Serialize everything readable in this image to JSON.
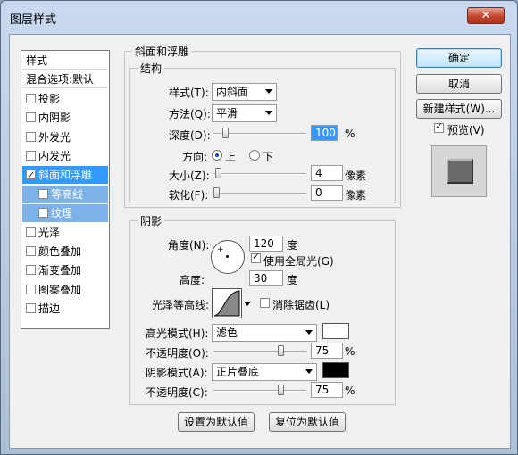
{
  "window": {
    "title": "图层样式",
    "close_glyph": "✕"
  },
  "left_list": [
    {
      "label": "样式",
      "checkbox": false,
      "state": "normal"
    },
    {
      "label": "混合选项:默认",
      "checkbox": false,
      "state": "normal"
    },
    {
      "label": "投影",
      "checkbox": true,
      "checked": false,
      "state": "normal"
    },
    {
      "label": "内阴影",
      "checkbox": true,
      "checked": false,
      "state": "normal"
    },
    {
      "label": "外发光",
      "checkbox": true,
      "checked": false,
      "state": "normal"
    },
    {
      "label": "内发光",
      "checkbox": true,
      "checked": false,
      "state": "normal"
    },
    {
      "label": "斜面和浮雕",
      "checkbox": true,
      "checked": true,
      "state": "selected"
    },
    {
      "label": "等高线",
      "checkbox": true,
      "checked": false,
      "state": "sub"
    },
    {
      "label": "纹理",
      "checkbox": true,
      "checked": false,
      "state": "sub"
    },
    {
      "label": "光泽",
      "checkbox": true,
      "checked": false,
      "state": "normal"
    },
    {
      "label": "颜色叠加",
      "checkbox": true,
      "checked": false,
      "state": "normal"
    },
    {
      "label": "渐变叠加",
      "checkbox": true,
      "checked": false,
      "state": "normal"
    },
    {
      "label": "图案叠加",
      "checkbox": true,
      "checked": false,
      "state": "normal"
    },
    {
      "label": "描边",
      "checkbox": true,
      "checked": false,
      "state": "normal"
    }
  ],
  "bevel": {
    "group_title": "斜面和浮雕",
    "structure_title": "结构",
    "style_label": "样式(T):",
    "style_value": "内斜面",
    "technique_label": "方法(Q):",
    "technique_value": "平滑",
    "depth_label": "深度(D):",
    "depth_value": "100",
    "depth_unit": "%",
    "depth_level": 0.1,
    "direction_label": "方向:",
    "dir_up": "上",
    "dir_down": "下",
    "size_label": "大小(Z):",
    "size_value": "4",
    "size_unit": "像素",
    "size_level": 0.02,
    "soften_label": "软化(F):",
    "soften_value": "0",
    "soften_unit": "像素",
    "soften_level": 0.0
  },
  "shading": {
    "title": "阴影",
    "angle_label": "角度(N):",
    "angle_value": "120",
    "angle_unit": "度",
    "global_light_label": "使用全局光(G)",
    "global_light_checked": true,
    "altitude_label": "高度:",
    "altitude_value": "30",
    "altitude_unit": "度",
    "gloss_label": "光泽等高线:",
    "antialias_label": "消除锯齿(L)",
    "antialias_checked": false,
    "highlight_mode_label": "高光模式(H):",
    "highlight_mode_value": "滤色",
    "highlight_color": "#ffffff",
    "highlight_opacity_label": "不透明度(O):",
    "highlight_opacity_value": "75",
    "highlight_opacity_unit": "%",
    "highlight_opacity_level": 0.75,
    "shadow_mode_label": "阴影模式(A):",
    "shadow_mode_value": "正片叠底",
    "shadow_color": "#000000",
    "shadow_opacity_label": "不透明度(C):",
    "shadow_opacity_value": "75",
    "shadow_opacity_unit": "%",
    "shadow_opacity_level": 0.75
  },
  "bottom": {
    "make_default": "设置为默认值",
    "reset_default": "复位为默认值"
  },
  "right": {
    "ok": "确定",
    "cancel": "取消",
    "new_style": "新建样式(W)...",
    "preview_label": "预览(V)",
    "preview_checked": true
  }
}
